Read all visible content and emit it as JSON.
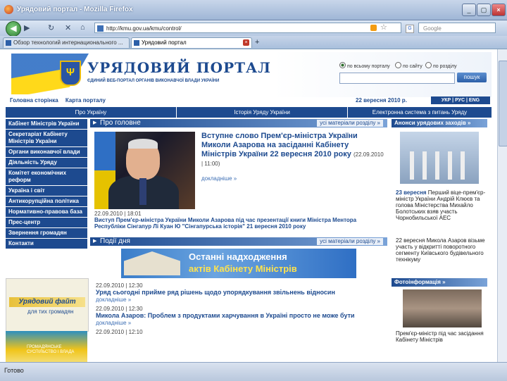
{
  "browser": {
    "window_title": "Урядовий портал - Mozilla Firefox",
    "url": "http://kmu.gov.ua/kmu/control/",
    "search_placeholder": "Google",
    "tabs": [
      {
        "label": "Обзор технологий интернационального ...",
        "active": false
      },
      {
        "label": "Урядовий портал",
        "active": true
      }
    ],
    "status": "Готово"
  },
  "site": {
    "title": "УРЯДОВИЙ ПОРТАЛ",
    "subtitle": "ЄДИНИЙ ВЕБ-ПОРТАЛ ОРГАНІВ ВИКОНАВЧОЇ ВЛАДИ УКРАЇНИ",
    "search_scopes": [
      "по всьому порталу",
      "по сайту",
      "по розділу"
    ],
    "search_button": "пошук",
    "top_links": [
      "Головна сторінка",
      "Карта порталу"
    ],
    "date": "22 вересня 2010 р.",
    "languages": "УКР | РУС | ENG",
    "main_nav": [
      "Про Україну",
      "Історія Уряду України",
      "Електронна система з питань Уряду"
    ]
  },
  "left_menu": [
    "Кабінет Міністрів України",
    "Секретаріат Кабінету Міністрів України",
    "Органи виконавчої влади",
    "Діяльність Уряду",
    "Комітет економічних реформ",
    "Україна і світ",
    "Антикорупційна політика",
    "Нормативно-правова база",
    "Прес-центр",
    "Звернення громадян",
    "Контакти"
  ],
  "banners": {
    "uryad_fajt_title": "Урядовий файт",
    "uryad_fajt_sub": "для тих громадян",
    "civil_society": "ГРОМАДЯНСЬКЕ СУСПІЛЬСТВО І ВЛАДА",
    "last_arrivals_line1": "Останні надходження",
    "last_arrivals_line2": "актів Кабінету Міністрів"
  },
  "main": {
    "about_header": "Про головне",
    "all_materials": "усі матеріали розділу »",
    "lead_title": "Вступне слово Прем'єр-міністра України Миколи Азарова на засіданні Кабінету Міністрів України 22 вересня 2010 року",
    "lead_date": "(22.09.2010 | 11:00)",
    "lead_more": "докладніше »",
    "photo_date": "22.09.2010 | 18:01",
    "photo_caption": "Виступ Прем'єр-міністра України Миколи Азарова під час презентації книги Міністра Ментора Республіки Сінгапур Лі Куан Ю \"Сінгапурська історія\" 21 вересня 2010 року",
    "events_header": "Події дня",
    "news": [
      {
        "date": "22.09.2010 | 12:30",
        "title": "Уряд сьогодні прийме ряд рішень щодо упорядкування звільнень відносин",
        "more": "докладніше »"
      },
      {
        "date": "22.09.2010 | 12:30",
        "title": "Микола Азаров: Проблем з продуктами харчування в Україні просто не може бути",
        "more": "докладніше »"
      },
      {
        "date": "22.09.2010 | 12:10",
        "title": "",
        "more": ""
      }
    ]
  },
  "right": {
    "news_header": "Анонси урядових заходів »",
    "announce_date": "23 вересня",
    "announce_text": "Перший віце-прем'єр-міністр України Андрій Клюєв та голова Міністерства Михайло Болотських взяв участь Чорнобильської АЕС",
    "announce2": "22 вересня Микола Азаров візьме участь у відкритті поворотного сегменту Київського будівельного технікуму",
    "photo_header": "Фотоінформація »",
    "photo_caption": "Прем'єр-міністр під час засідання Кабінету Міністрів"
  }
}
